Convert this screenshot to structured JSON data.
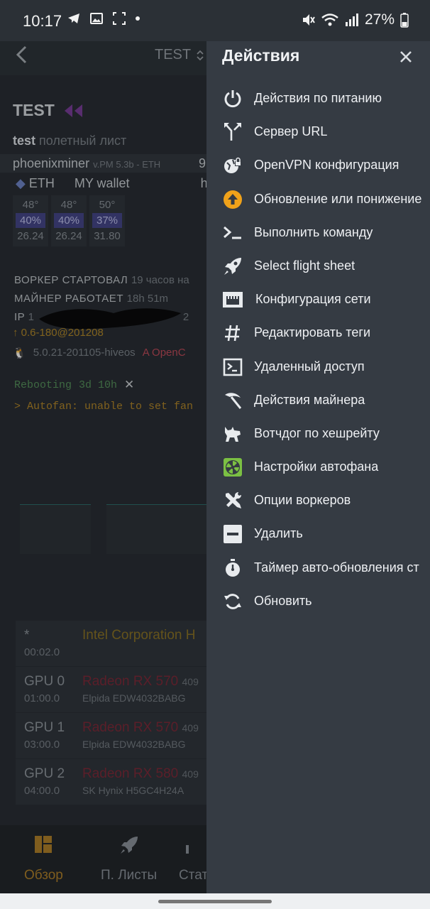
{
  "status_bar": {
    "time": "10:17",
    "battery": "27%",
    "icons": [
      "telegram-icon",
      "gallery-icon",
      "screenshot-icon",
      "dot-icon",
      "mute-icon",
      "wifi-icon",
      "signal-icon",
      "battery-icon"
    ]
  },
  "background": {
    "worker_select": "TEST",
    "worker_title": "TEST",
    "flight_sheet_name": "test",
    "flight_sheet_suffix": "полетный лист",
    "miner_name": "phoenixminer",
    "miner_version": "v.PM 5.3b - ETH",
    "miner_extra": "9",
    "coin": "ETH",
    "wallet": "MY wallet",
    "wallet_extra": "hi",
    "gpus": [
      {
        "temp": "48°",
        "fan": "40%",
        "hash": "26.24"
      },
      {
        "temp": "48°",
        "fan": "40%",
        "hash": "26.24"
      },
      {
        "temp": "50°",
        "fan": "37%",
        "hash": "31.80"
      }
    ],
    "worker_started_label": "ВОРКЕР СТАРТОВАЛ",
    "worker_started_value": "19 часов на",
    "miner_running_label": "МАЙНЕР РАБОТАЕТ",
    "miner_running_value": "18h 51m",
    "ip_label": "IP",
    "ip_value": "1",
    "ip_suffix": "2",
    "version": "0.6-180@201208",
    "kernel": "5.0.21-201105-hiveos",
    "opencl": "OpenC",
    "reboot_status": "Rebooting",
    "reboot_time": "3d 10h",
    "autofan_message": "> Autofan: unable to set fan",
    "pci": [
      {
        "slot": "*",
        "bus": "00:02.0",
        "name": "Intel Corporation H",
        "mem": "",
        "extra": ""
      },
      {
        "slot": "GPU 0",
        "bus": "01:00.0",
        "name": "Radeon RX 570",
        "mem": "409",
        "extra": "Elpida EDW4032BABG"
      },
      {
        "slot": "GPU 1",
        "bus": "03:00.0",
        "name": "Radeon RX 570",
        "mem": "409",
        "extra": "Elpida EDW4032BABG"
      },
      {
        "slot": "GPU 2",
        "bus": "04:00.0",
        "name": "Radeon RX 580",
        "mem": "409",
        "extra": "SK Hynix H5GC4H24A"
      }
    ],
    "nav": [
      {
        "label": "Обзор",
        "icon": "dashboard-icon"
      },
      {
        "label": "П. Листы",
        "icon": "rocket-icon"
      },
      {
        "label": "Стат",
        "icon": "stats-icon"
      }
    ]
  },
  "drawer": {
    "title": "Действия",
    "items": [
      {
        "label": "Действия по питанию",
        "icon": "power-icon"
      },
      {
        "label": "Сервер URL",
        "icon": "fork-icon"
      },
      {
        "label": "OpenVPN конфигурация",
        "icon": "vpn-icon"
      },
      {
        "label": "Обновление или понижение",
        "icon": "upgrade-icon"
      },
      {
        "label": "Выполнить команду",
        "icon": "terminal-icon"
      },
      {
        "label": "Select flight sheet",
        "icon": "rocket-icon"
      },
      {
        "label": "Конфигурация сети",
        "icon": "network-icon"
      },
      {
        "label": "Редактировать теги",
        "icon": "hash-icon"
      },
      {
        "label": "Удаленный доступ",
        "icon": "remote-access-icon"
      },
      {
        "label": "Действия майнера",
        "icon": "pickaxe-icon"
      },
      {
        "label": "Вотчдог по хешрейту",
        "icon": "watchdog-icon"
      },
      {
        "label": "Настройки автофана",
        "icon": "fan-icon"
      },
      {
        "label": "Опции воркеров",
        "icon": "tools-icon"
      },
      {
        "label": "Удалить",
        "icon": "minus-icon"
      },
      {
        "label": "Таймер авто-обновления ст",
        "icon": "stopwatch-icon"
      },
      {
        "label": "Обновить",
        "icon": "refresh-icon"
      }
    ]
  },
  "colors": {
    "drawer_bg": "#353b43",
    "upgrade_accent": "#f0a21a",
    "fan_accent": "#7bc043"
  }
}
